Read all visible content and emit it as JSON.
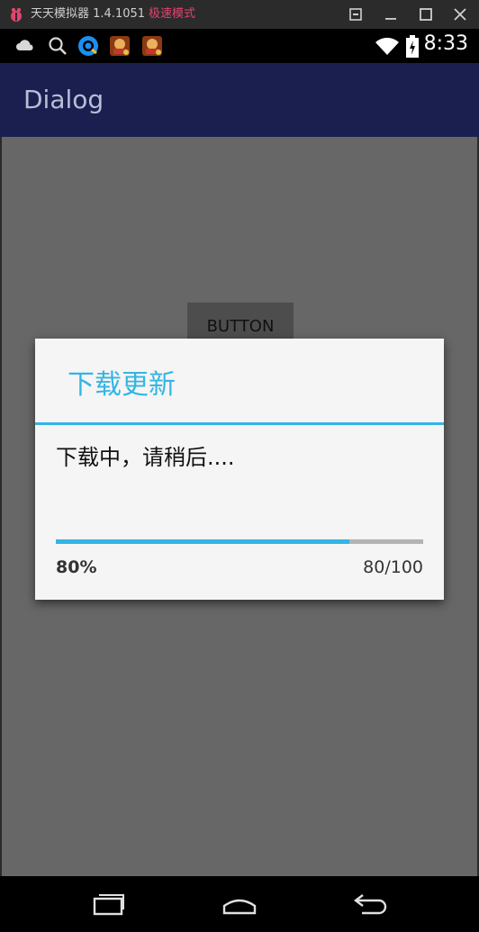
{
  "emulator": {
    "title": "天天模拟器 1.4.1051",
    "mode": "极速模式",
    "mode_color": "#e0456f",
    "controls": [
      "restore-icon",
      "minimize-icon",
      "maximize-icon",
      "close-icon"
    ]
  },
  "statusbar": {
    "time": "8:33",
    "left_icons": [
      "cloud-icon",
      "search-icon",
      "qq-browser-icon",
      "game-app-icon",
      "game-app-icon"
    ],
    "right_icons": [
      "wifi-icon",
      "battery-icon"
    ]
  },
  "actionbar": {
    "title": "Dialog",
    "background": "#1a1f4f"
  },
  "content": {
    "button_label": "BUTTON"
  },
  "dialog": {
    "title": "下载更新",
    "message": "下载中，请稍后....",
    "accent_color": "#33b5e5",
    "progress": {
      "value": 80,
      "max": 100,
      "percent_label": "80%",
      "count_label": "80/100"
    }
  },
  "navbar": {
    "buttons": [
      "recent-apps-icon",
      "home-icon",
      "back-icon"
    ]
  }
}
